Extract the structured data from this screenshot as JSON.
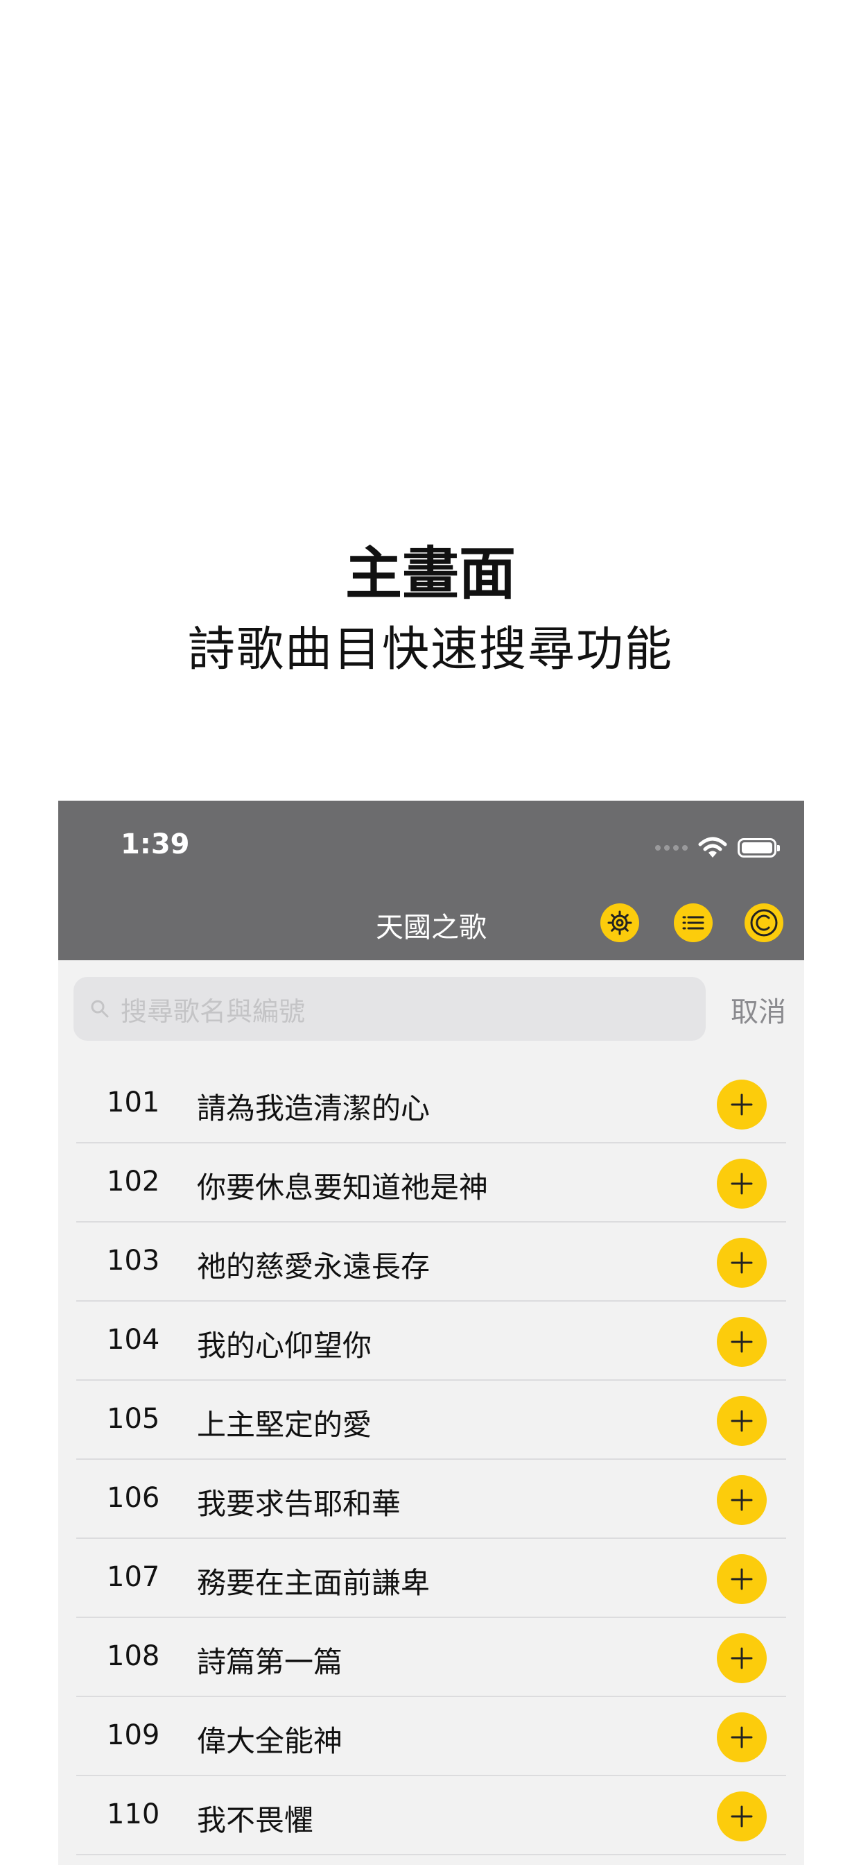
{
  "caption": {
    "title": "主畫面",
    "subtitle": "詩歌曲目快速搜尋功能"
  },
  "status_bar": {
    "time": "1:39",
    "icons": [
      "signal-dots-icon",
      "wifi-icon",
      "battery-icon"
    ]
  },
  "nav": {
    "title": "天國之歌",
    "buttons": [
      "gear-icon",
      "list-icon",
      "copyright-icon"
    ]
  },
  "search": {
    "placeholder": "搜尋歌名與編號",
    "cancel_label": "取消"
  },
  "songs": [
    {
      "number": "101",
      "title": "請為我造清潔的心"
    },
    {
      "number": "102",
      "title": "你要休息要知道祂是神"
    },
    {
      "number": "103",
      "title": "祂的慈愛永遠長存"
    },
    {
      "number": "104",
      "title": "我的心仰望你"
    },
    {
      "number": "105",
      "title": "上主堅定的愛"
    },
    {
      "number": "106",
      "title": "我要求告耶和華"
    },
    {
      "number": "107",
      "title": "務要在主面前謙卑"
    },
    {
      "number": "108",
      "title": "詩篇第一篇"
    },
    {
      "number": "109",
      "title": "偉大全能神"
    },
    {
      "number": "110",
      "title": "我不畏懼"
    }
  ],
  "colors": {
    "accent": "#fccc0c",
    "nav_background": "#6c6c6e",
    "list_background": "#f2f2f2"
  }
}
